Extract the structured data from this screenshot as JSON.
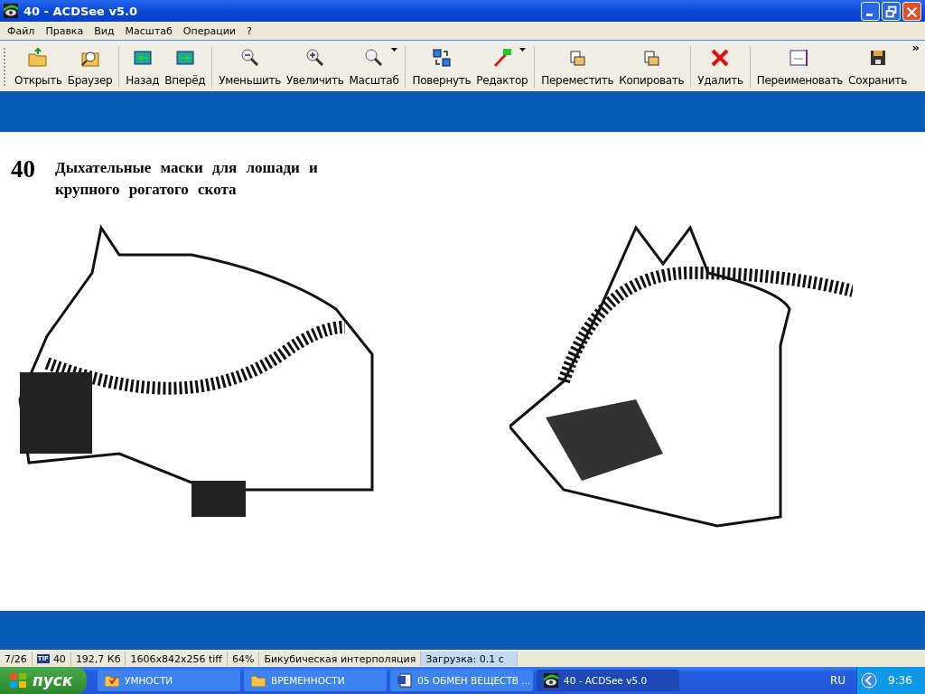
{
  "window": {
    "title": "40 - ACDSee v5.0"
  },
  "menu": [
    "Файл",
    "Правка",
    "Вид",
    "Масштаб",
    "Операции",
    "?"
  ],
  "toolbar": {
    "groups": [
      [
        {
          "label": "Открыть",
          "dropdown": false
        },
        {
          "label": "Браузер",
          "dropdown": false
        }
      ],
      [
        {
          "label": "Назад",
          "dropdown": false
        },
        {
          "label": "Вперёд",
          "dropdown": false
        }
      ],
      [
        {
          "label": "Уменьшить",
          "dropdown": false
        },
        {
          "label": "Увеличить",
          "dropdown": false
        },
        {
          "label": "Масштаб",
          "dropdown": true
        }
      ],
      [
        {
          "label": "Повернуть",
          "dropdown": false
        },
        {
          "label": "Редактор",
          "dropdown": true
        }
      ],
      [
        {
          "label": "Переместить",
          "dropdown": false
        },
        {
          "label": "Копировать",
          "dropdown": false
        }
      ],
      [
        {
          "label": "Удалить",
          "dropdown": false
        }
      ],
      [
        {
          "label": "Переименовать",
          "dropdown": false
        },
        {
          "label": "Сохранить",
          "dropdown": false
        }
      ]
    ],
    "overflow": "»"
  },
  "document": {
    "number": "40",
    "heading": "Дыхательные маски для лошади и крупного рогатого скота"
  },
  "status_bar": [
    {
      "text": "7/26",
      "highlighted": false
    },
    {
      "text": "40",
      "highlighted": false,
      "icon_text": "TIF"
    },
    {
      "text": "192,7 Кб",
      "highlighted": false
    },
    {
      "text": "1606x842x256 tiff",
      "highlighted": false
    },
    {
      "text": "64%",
      "highlighted": false
    },
    {
      "text": "Бикубическая интерполяция",
      "highlighted": false
    },
    {
      "text": "Загрузка: 0.1 с",
      "highlighted": true
    }
  ],
  "taskbar": {
    "start": "пуск",
    "items": [
      {
        "label": "УМНОСТИ",
        "selected": false
      },
      {
        "label": "ВРЕМЕННОСТИ",
        "selected": false
      },
      {
        "label": "05 ОБМЕН ВЕЩЕСТВ ...",
        "selected": false
      },
      {
        "label": "40 - ACDSee v5.0",
        "selected": true
      }
    ],
    "language": "RU",
    "clock": "9:36"
  }
}
